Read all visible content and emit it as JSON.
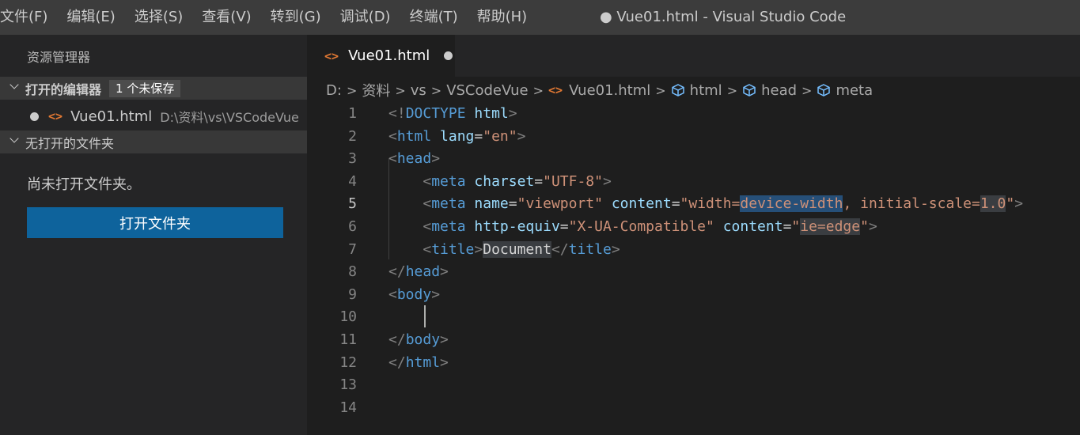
{
  "menu": {
    "items": [
      "文件(F)",
      "编辑(E)",
      "选择(S)",
      "查看(V)",
      "转到(G)",
      "调试(D)",
      "终端(T)",
      "帮助(H)"
    ],
    "window_title": "● Vue01.html - Visual Studio Code"
  },
  "sidebar": {
    "title": "资源管理器",
    "open_editors": {
      "label": "打开的编辑器",
      "badge": "1 个未保存",
      "file_name": "Vue01.html",
      "file_path": "D:\\资料\\vs\\VSCodeVue"
    },
    "no_folder": {
      "label": "无打开的文件夹",
      "message": "尚未打开文件夹。",
      "button": "打开文件夹"
    }
  },
  "tab": {
    "label": "Vue01.html"
  },
  "breadcrumb": {
    "items": [
      "D:",
      "资料",
      "vs",
      "VSCodeVue",
      "Vue01.html",
      "html",
      "head",
      "meta"
    ]
  },
  "icons": {
    "html_file": "html-file-icon",
    "modified_dot": "unsaved-dot-icon",
    "symbol": "cube-symbol-icon",
    "chevron": "chevron-down-icon",
    "breadcrumb_separator": "chevron-right-icon"
  },
  "colors": {
    "button": "#0e639c",
    "tag": "#569cd6",
    "attribute": "#9cdcfe",
    "string": "#ce9178",
    "html_icon": "#e37933"
  },
  "editor": {
    "active_line": "5",
    "line_numbers": [
      "1",
      "2",
      "3",
      "4",
      "5",
      "6",
      "7",
      "8",
      "9",
      "10",
      "11",
      "12",
      "13",
      "14"
    ],
    "lines": [
      [
        [
          "p",
          "<!"
        ],
        [
          "t",
          "DOCTYPE"
        ],
        [
          "w",
          " "
        ],
        [
          "a",
          "html"
        ],
        [
          "p",
          ">"
        ]
      ],
      [
        [
          "p",
          "<"
        ],
        [
          "t",
          "html"
        ],
        [
          "w",
          " "
        ],
        [
          "a",
          "lang"
        ],
        [
          "w",
          "="
        ],
        [
          "s",
          "\"en\""
        ],
        [
          "p",
          ">"
        ]
      ],
      [
        [
          "p",
          "<"
        ],
        [
          "t",
          "head"
        ],
        [
          "p",
          ">"
        ]
      ],
      [
        [
          "w",
          "    "
        ],
        [
          "p",
          "<"
        ],
        [
          "t",
          "meta"
        ],
        [
          "w",
          " "
        ],
        [
          "a",
          "charset"
        ],
        [
          "w",
          "="
        ],
        [
          "s",
          "\"UTF-8\""
        ],
        [
          "p",
          ">"
        ]
      ],
      [
        [
          "w",
          "    "
        ],
        [
          "p",
          "<"
        ],
        [
          "t",
          "meta"
        ],
        [
          "w",
          " "
        ],
        [
          "a",
          "name"
        ],
        [
          "w",
          "="
        ],
        [
          "s",
          "\"viewport\""
        ],
        [
          "w",
          " "
        ],
        [
          "a",
          "content"
        ],
        [
          "w",
          "="
        ],
        [
          "s",
          "\"width="
        ],
        [
          "shl",
          "device-width"
        ],
        [
          "s",
          ", initial-scale="
        ],
        [
          "shl2",
          "1.0"
        ],
        [
          "s",
          "\""
        ],
        [
          "p",
          ">"
        ]
      ],
      [
        [
          "w",
          "    "
        ],
        [
          "p",
          "<"
        ],
        [
          "t",
          "meta"
        ],
        [
          "w",
          " "
        ],
        [
          "a",
          "http-equiv"
        ],
        [
          "w",
          "="
        ],
        [
          "s",
          "\"X-UA-Compatible\""
        ],
        [
          "w",
          " "
        ],
        [
          "a",
          "content"
        ],
        [
          "w",
          "="
        ],
        [
          "s",
          "\""
        ],
        [
          "shl2",
          "ie=edge"
        ],
        [
          "s",
          "\""
        ],
        [
          "p",
          ">"
        ]
      ],
      [
        [
          "w",
          "    "
        ],
        [
          "p",
          "<"
        ],
        [
          "t",
          "title"
        ],
        [
          "p",
          ">"
        ],
        [
          "whl2",
          "Document"
        ],
        [
          "p",
          "</"
        ],
        [
          "t",
          "title"
        ],
        [
          "p",
          ">"
        ]
      ],
      [
        [
          "p",
          "</"
        ],
        [
          "t",
          "head"
        ],
        [
          "p",
          ">"
        ]
      ],
      [
        [
          "p",
          "<"
        ],
        [
          "t",
          "body"
        ],
        [
          "p",
          ">"
        ]
      ],
      [],
      [
        [
          "p",
          "</"
        ],
        [
          "t",
          "body"
        ],
        [
          "p",
          ">"
        ]
      ],
      [
        [
          "p",
          "</"
        ],
        [
          "t",
          "html"
        ],
        [
          "p",
          ">"
        ]
      ],
      [],
      []
    ]
  }
}
